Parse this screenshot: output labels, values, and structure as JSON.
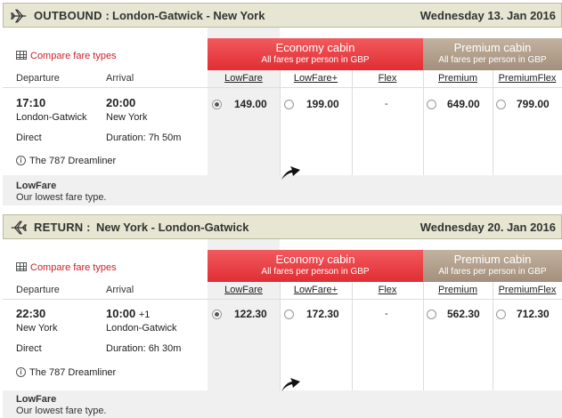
{
  "outbound": {
    "direction": "OUTBOUND :",
    "route": "London-Gatwick - New York",
    "date": "Wednesday 13. Jan 2016",
    "compare_label": "Compare fare types",
    "economy_title": "Economy cabin",
    "economy_sub": "All fares per person in GBP",
    "premium_title": "Premium cabin",
    "premium_sub": "All fares per person in GBP",
    "departure_hdr": "Departure",
    "arrival_hdr": "Arrival",
    "fare_types": [
      "LowFare",
      "LowFare+",
      "Flex",
      "Premium",
      "PremiumFlex"
    ],
    "dep_time": "17:10",
    "arr_time": "20:00",
    "arr_suffix": "",
    "dep_city": "London-Gatwick",
    "arr_city": "New York",
    "stops": "Direct",
    "duration": "Duration: 7h 50m",
    "aircraft": "The 787 Dreamliner",
    "prices": [
      "149.00",
      "199.00",
      "-",
      "649.00",
      "799.00"
    ],
    "selected_index": 0,
    "note_title": "LowFare",
    "note_desc": "Our lowest fare type."
  },
  "return": {
    "direction": "RETURN :",
    "route": "New York - London-Gatwick",
    "date": "Wednesday 20. Jan 2016",
    "compare_label": "Compare fare types",
    "economy_title": "Economy cabin",
    "economy_sub": "All fares per person in GBP",
    "premium_title": "Premium cabin",
    "premium_sub": "All fares per person in GBP",
    "departure_hdr": "Departure",
    "arrival_hdr": "Arrival",
    "fare_types": [
      "LowFare",
      "LowFare+",
      "Flex",
      "Premium",
      "PremiumFlex"
    ],
    "dep_time": "22:30",
    "arr_time": "10:00",
    "arr_suffix": "+1",
    "dep_city": "New York",
    "arr_city": "London-Gatwick",
    "stops": "Direct",
    "duration": "Duration: 6h 30m",
    "aircraft": "The 787 Dreamliner",
    "prices": [
      "122.30",
      "172.30",
      "-",
      "562.30",
      "712.30"
    ],
    "selected_index": 0,
    "note_title": "LowFare",
    "note_desc": "Our lowest fare type."
  },
  "colors": {
    "economy": "#e02d33",
    "premium": "#a38f7c",
    "link_red": "#cc2127",
    "header_bg": "#e7e6d2"
  },
  "icons": {
    "plane": "plane-icon",
    "grid": "table-grid-icon",
    "info": "info-icon",
    "cursor": "mouse-cursor-icon"
  }
}
